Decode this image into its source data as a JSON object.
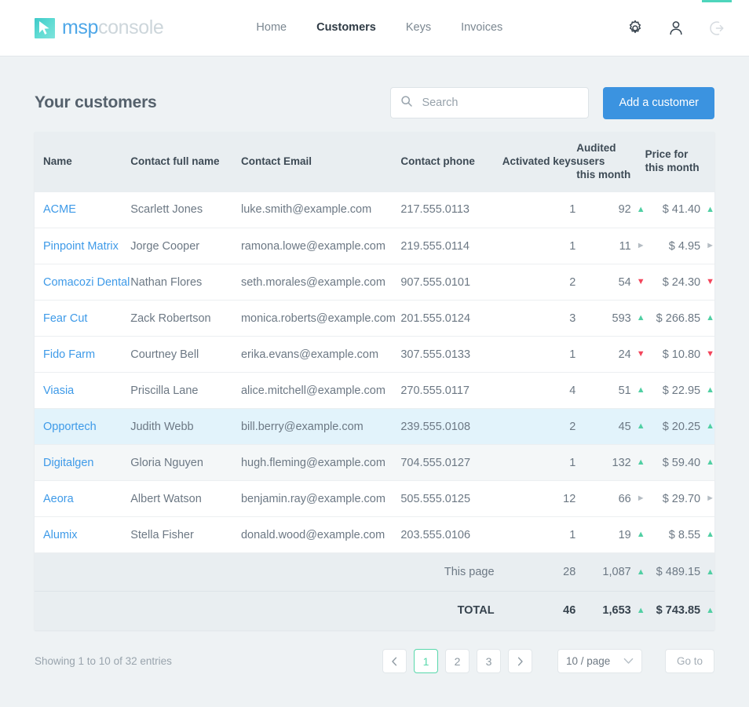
{
  "brand": {
    "part1": "msp",
    "part2": "console",
    "mark_icon": "cursor-arrow-icon"
  },
  "nav": {
    "links": [
      {
        "label": "Home",
        "active": false
      },
      {
        "label": "Customers",
        "active": true
      },
      {
        "label": "Keys",
        "active": false
      },
      {
        "label": "Invoices",
        "active": false
      }
    ],
    "icons": [
      {
        "name": "gear-icon"
      },
      {
        "name": "user-icon"
      },
      {
        "name": "logout-icon"
      }
    ]
  },
  "header": {
    "title": "Your customers",
    "search_placeholder": "Search",
    "search_value": "",
    "search_icon": "search-icon",
    "add_button": "Add a customer"
  },
  "colors": {
    "accent_teal": "#4ed5bc",
    "link_blue": "#3e9ae8",
    "button_blue": "#3b93e0",
    "trend_up": "#50cfa3",
    "trend_down": "#f3455b",
    "trend_flat": "#b4bcc3",
    "page_active": "#58d8ab"
  },
  "table": {
    "columns": [
      "Name",
      "Contact full name",
      "Contact Email",
      "Contact phone",
      "Activated keys",
      "Audited users this month",
      "Price for this month"
    ],
    "column_lines": {
      "users": [
        "Audited users",
        "this month"
      ],
      "price": [
        "Price for",
        "this month"
      ]
    },
    "rows": [
      {
        "name": "ACME",
        "contact": "Scarlett Jones",
        "email": "luke.smith@example.com",
        "phone": "217.555.0113",
        "keys": "1",
        "users": "92",
        "users_trend": "up",
        "price": "$ 41.40",
        "price_trend": "up",
        "style": "normal"
      },
      {
        "name": "Pinpoint Matrix",
        "contact": "Jorge Cooper",
        "email": "ramona.lowe@example.com",
        "phone": "219.555.0114",
        "keys": "1",
        "users": "11",
        "users_trend": "flat",
        "price": "$ 4.95",
        "price_trend": "flat",
        "style": "normal"
      },
      {
        "name": "Comacozi Dental",
        "contact": "Nathan Flores",
        "email": "seth.morales@example.com",
        "phone": "907.555.0101",
        "keys": "2",
        "users": "54",
        "users_trend": "down",
        "price": "$ 24.30",
        "price_trend": "down",
        "style": "normal"
      },
      {
        "name": "Fear Cut",
        "contact": "Zack Robertson",
        "email": "monica.roberts@example.com",
        "phone": "201.555.0124",
        "keys": "3",
        "users": "593",
        "users_trend": "up",
        "price": "$ 266.85",
        "price_trend": "up",
        "style": "normal"
      },
      {
        "name": "Fido Farm",
        "contact": "Courtney Bell",
        "email": "erika.evans@example.com",
        "phone": "307.555.0133",
        "keys": "1",
        "users": "24",
        "users_trend": "down",
        "price": "$ 10.80",
        "price_trend": "down",
        "style": "normal"
      },
      {
        "name": "Viasia",
        "contact": "Priscilla Lane",
        "email": "alice.mitchell@example.com",
        "phone": "270.555.0117",
        "keys": "4",
        "users": "51",
        "users_trend": "up",
        "price": "$ 22.95",
        "price_trend": "up",
        "style": "normal"
      },
      {
        "name": "Opportech",
        "contact": "Judith Webb",
        "email": "bill.berry@example.com",
        "phone": "239.555.0108",
        "keys": "2",
        "users": "45",
        "users_trend": "up",
        "price": "$ 20.25",
        "price_trend": "up",
        "style": "hover"
      },
      {
        "name": "Digitalgen",
        "contact": "Gloria Nguyen",
        "email": "hugh.fleming@example.com",
        "phone": "704.555.0127",
        "keys": "1",
        "users": "132",
        "users_trend": "up",
        "price": "$ 59.40",
        "price_trend": "up",
        "style": "alt"
      },
      {
        "name": "Aeora",
        "contact": "Albert Watson",
        "email": "benjamin.ray@example.com",
        "phone": "505.555.0125",
        "keys": "12",
        "users": "66",
        "users_trend": "flat",
        "price": "$ 29.70",
        "price_trend": "flat",
        "style": "normal"
      },
      {
        "name": "Alumix",
        "contact": "Stella Fisher",
        "email": "donald.wood@example.com",
        "phone": "203.555.0106",
        "keys": "1",
        "users": "19",
        "users_trend": "up",
        "price": "$ 8.55",
        "price_trend": "up",
        "style": "normal"
      }
    ],
    "footer": [
      {
        "label": "This page",
        "keys": "28",
        "users": "1,087",
        "users_trend": "up",
        "price": "$ 489.15",
        "price_trend": "up",
        "bold": false
      },
      {
        "label": "TOTAL",
        "keys": "46",
        "users": "1,653",
        "users_trend": "up",
        "price": "$ 743.85",
        "price_trend": "up",
        "bold": true
      }
    ]
  },
  "pagination": {
    "showing": "Showing 1 to 10 of 32 entries",
    "prev_icon": "chevron-left-icon",
    "next_icon": "chevron-right-icon",
    "pages": [
      "1",
      "2",
      "3"
    ],
    "active_page": "1",
    "per_page": "10 / page",
    "per_page_icon": "chevron-down-icon",
    "goto": "Go to"
  }
}
